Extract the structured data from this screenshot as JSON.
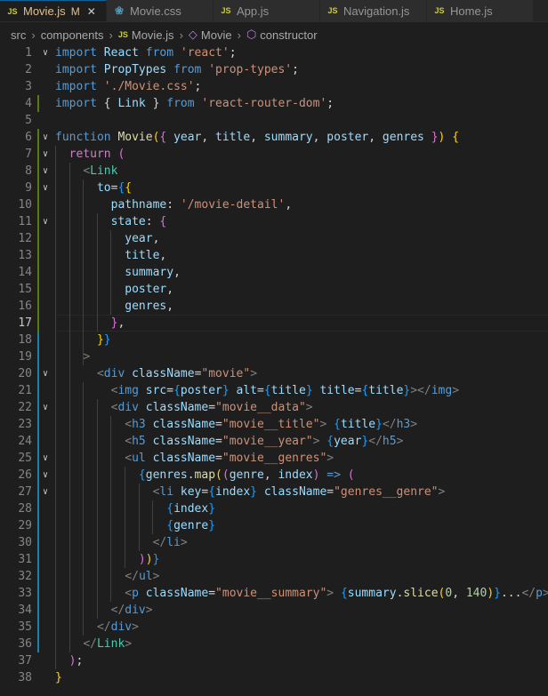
{
  "tabs": [
    {
      "label": "Movie.js",
      "icon": "js-file-icon",
      "modified": "M",
      "active": true
    },
    {
      "label": "Movie.css",
      "icon": "css-file-icon",
      "active": false
    },
    {
      "label": "App.js",
      "icon": "js-file-icon",
      "active": false
    },
    {
      "label": "Navigation.js",
      "icon": "js-file-icon",
      "active": false
    },
    {
      "label": "Home.js",
      "icon": "js-file-icon",
      "active": false
    }
  ],
  "breadcrumb": [
    "src",
    "components",
    "Movie.js",
    "Movie",
    "constructor"
  ],
  "editor": {
    "current_line": 17,
    "lines": [
      {
        "n": 1,
        "fold": true,
        "tokens": [
          [
            "import ",
            "kw"
          ],
          [
            "React ",
            "var"
          ],
          [
            "from ",
            "kw"
          ],
          [
            "'react'",
            "str"
          ],
          [
            ";",
            "pun"
          ]
        ]
      },
      {
        "n": 2,
        "tokens": [
          [
            "import ",
            "kw"
          ],
          [
            "PropTypes ",
            "var"
          ],
          [
            "from ",
            "kw"
          ],
          [
            "'prop-types'",
            "str"
          ],
          [
            ";",
            "pun"
          ]
        ]
      },
      {
        "n": 3,
        "tokens": [
          [
            "import ",
            "kw"
          ],
          [
            "'./Movie.css'",
            "str"
          ],
          [
            ";",
            "pun"
          ]
        ]
      },
      {
        "n": 4,
        "tokens": [
          [
            "import ",
            "kw"
          ],
          [
            "{ ",
            "pun"
          ],
          [
            "Link ",
            "var"
          ],
          [
            "} ",
            "pun"
          ],
          [
            "from ",
            "kw"
          ],
          [
            "'react-router-dom'",
            "str"
          ],
          [
            ";",
            "pun"
          ]
        ]
      },
      {
        "n": 5,
        "tokens": []
      },
      {
        "n": 6,
        "fold": true,
        "tokens": [
          [
            "function ",
            "kw"
          ],
          [
            "Movie",
            "fn"
          ],
          [
            "(",
            "br1"
          ],
          [
            "{ ",
            "br2"
          ],
          [
            "year",
            "var"
          ],
          [
            ", ",
            "pun"
          ],
          [
            "title",
            "var"
          ],
          [
            ", ",
            "pun"
          ],
          [
            "summary",
            "var"
          ],
          [
            ", ",
            "pun"
          ],
          [
            "poster",
            "var"
          ],
          [
            ", ",
            "pun"
          ],
          [
            "genres ",
            "var"
          ],
          [
            "}",
            "br2"
          ],
          [
            ") ",
            "br1"
          ],
          [
            "{",
            "br1"
          ]
        ]
      },
      {
        "n": 7,
        "fold": true,
        "tokens": [
          [
            "  "
          ],
          [
            "return ",
            "ctl"
          ],
          [
            "(",
            "br2"
          ]
        ]
      },
      {
        "n": 8,
        "fold": true,
        "tokens": [
          [
            "    "
          ],
          [
            "<",
            "ang"
          ],
          [
            "Link",
            "comp"
          ]
        ]
      },
      {
        "n": 9,
        "fold": true,
        "tokens": [
          [
            "      "
          ],
          [
            "to",
            "attr"
          ],
          [
            "=",
            "pun"
          ],
          [
            "{",
            "br3"
          ],
          [
            "{",
            "br1"
          ]
        ]
      },
      {
        "n": 10,
        "tokens": [
          [
            "        "
          ],
          [
            "pathname",
            "attr"
          ],
          [
            ": ",
            "pun"
          ],
          [
            "'/movie-detail'",
            "str"
          ],
          [
            ",",
            "pun"
          ]
        ]
      },
      {
        "n": 11,
        "fold": true,
        "tokens": [
          [
            "        "
          ],
          [
            "state",
            "attr"
          ],
          [
            ": ",
            "pun"
          ],
          [
            "{",
            "br2"
          ]
        ]
      },
      {
        "n": 12,
        "tokens": [
          [
            "          "
          ],
          [
            "year",
            "var"
          ],
          [
            ",",
            "pun"
          ]
        ]
      },
      {
        "n": 13,
        "tokens": [
          [
            "          "
          ],
          [
            "title",
            "var"
          ],
          [
            ",",
            "pun"
          ]
        ]
      },
      {
        "n": 14,
        "tokens": [
          [
            "          "
          ],
          [
            "summary",
            "var"
          ],
          [
            ",",
            "pun"
          ]
        ]
      },
      {
        "n": 15,
        "tokens": [
          [
            "          "
          ],
          [
            "poster",
            "var"
          ],
          [
            ",",
            "pun"
          ]
        ]
      },
      {
        "n": 16,
        "tokens": [
          [
            "          "
          ],
          [
            "genres",
            "var"
          ],
          [
            ",",
            "pun"
          ]
        ]
      },
      {
        "n": 17,
        "tokens": [
          [
            "        "
          ],
          [
            "}",
            "br2"
          ],
          [
            ",",
            "pun"
          ]
        ]
      },
      {
        "n": 18,
        "tokens": [
          [
            "      "
          ],
          [
            "}",
            "br1"
          ],
          [
            "}",
            "br3"
          ]
        ]
      },
      {
        "n": 19,
        "tokens": [
          [
            "    "
          ],
          [
            ">",
            "ang"
          ]
        ]
      },
      {
        "n": 20,
        "fold": true,
        "tokens": [
          [
            "      "
          ],
          [
            "<",
            "ang"
          ],
          [
            "div ",
            "tag"
          ],
          [
            "className",
            "attr"
          ],
          [
            "=",
            "pun"
          ],
          [
            "\"movie\"",
            "str"
          ],
          [
            ">",
            "ang"
          ]
        ]
      },
      {
        "n": 21,
        "tokens": [
          [
            "        "
          ],
          [
            "<",
            "ang"
          ],
          [
            "img ",
            "tag"
          ],
          [
            "src",
            "attr"
          ],
          [
            "=",
            "pun"
          ],
          [
            "{",
            "br3"
          ],
          [
            "poster",
            "var"
          ],
          [
            "} ",
            "br3"
          ],
          [
            "alt",
            "attr"
          ],
          [
            "=",
            "pun"
          ],
          [
            "{",
            "br3"
          ],
          [
            "title",
            "var"
          ],
          [
            "} ",
            "br3"
          ],
          [
            "title",
            "attr"
          ],
          [
            "=",
            "pun"
          ],
          [
            "{",
            "br3"
          ],
          [
            "title",
            "var"
          ],
          [
            "}",
            "br3"
          ],
          [
            "></",
            "ang"
          ],
          [
            "img",
            "tag"
          ],
          [
            ">",
            "ang"
          ]
        ]
      },
      {
        "n": 22,
        "fold": true,
        "tokens": [
          [
            "        "
          ],
          [
            "<",
            "ang"
          ],
          [
            "div ",
            "tag"
          ],
          [
            "className",
            "attr"
          ],
          [
            "=",
            "pun"
          ],
          [
            "\"movie__data\"",
            "str"
          ],
          [
            ">",
            "ang"
          ]
        ]
      },
      {
        "n": 23,
        "tokens": [
          [
            "          "
          ],
          [
            "<",
            "ang"
          ],
          [
            "h3 ",
            "tag"
          ],
          [
            "className",
            "attr"
          ],
          [
            "=",
            "pun"
          ],
          [
            "\"movie__title\"",
            "str"
          ],
          [
            "> ",
            "ang"
          ],
          [
            "{",
            "br3"
          ],
          [
            "title",
            "var"
          ],
          [
            "}",
            "br3"
          ],
          [
            "</",
            "ang"
          ],
          [
            "h3",
            "tag"
          ],
          [
            ">",
            "ang"
          ]
        ]
      },
      {
        "n": 24,
        "tokens": [
          [
            "          "
          ],
          [
            "<",
            "ang"
          ],
          [
            "h5 ",
            "tag"
          ],
          [
            "className",
            "attr"
          ],
          [
            "=",
            "pun"
          ],
          [
            "\"movie__year\"",
            "str"
          ],
          [
            "> ",
            "ang"
          ],
          [
            "{",
            "br3"
          ],
          [
            "year",
            "var"
          ],
          [
            "}",
            "br3"
          ],
          [
            "</",
            "ang"
          ],
          [
            "h5",
            "tag"
          ],
          [
            ">",
            "ang"
          ]
        ]
      },
      {
        "n": 25,
        "fold": true,
        "tokens": [
          [
            "          "
          ],
          [
            "<",
            "ang"
          ],
          [
            "ul ",
            "tag"
          ],
          [
            "className",
            "attr"
          ],
          [
            "=",
            "pun"
          ],
          [
            "\"movie__genres\"",
            "str"
          ],
          [
            ">",
            "ang"
          ]
        ]
      },
      {
        "n": 26,
        "fold": true,
        "tokens": [
          [
            "            "
          ],
          [
            "{",
            "br3"
          ],
          [
            "genres",
            "var"
          ],
          [
            ".",
            "pun"
          ],
          [
            "map",
            "fn"
          ],
          [
            "(",
            "br1"
          ],
          [
            "(",
            "br2"
          ],
          [
            "genre",
            "var"
          ],
          [
            ", ",
            "pun"
          ],
          [
            "index",
            "var"
          ],
          [
            ") ",
            "br2"
          ],
          [
            "=> ",
            "kw"
          ],
          [
            "(",
            "br2"
          ]
        ]
      },
      {
        "n": 27,
        "fold": true,
        "tokens": [
          [
            "              "
          ],
          [
            "<",
            "ang"
          ],
          [
            "li ",
            "tag"
          ],
          [
            "key",
            "attr"
          ],
          [
            "=",
            "pun"
          ],
          [
            "{",
            "br3"
          ],
          [
            "index",
            "var"
          ],
          [
            "} ",
            "br3"
          ],
          [
            "className",
            "attr"
          ],
          [
            "=",
            "pun"
          ],
          [
            "\"genres__genre\"",
            "str"
          ],
          [
            ">",
            "ang"
          ]
        ]
      },
      {
        "n": 28,
        "tokens": [
          [
            "                "
          ],
          [
            "{",
            "br3"
          ],
          [
            "index",
            "var"
          ],
          [
            "}",
            "br3"
          ]
        ]
      },
      {
        "n": 29,
        "tokens": [
          [
            "                "
          ],
          [
            "{",
            "br3"
          ],
          [
            "genre",
            "var"
          ],
          [
            "}",
            "br3"
          ]
        ]
      },
      {
        "n": 30,
        "tokens": [
          [
            "              "
          ],
          [
            "</",
            "ang"
          ],
          [
            "li",
            "tag"
          ],
          [
            ">",
            "ang"
          ]
        ]
      },
      {
        "n": 31,
        "tokens": [
          [
            "            "
          ],
          [
            ")",
            "br2"
          ],
          [
            ")",
            "br1"
          ],
          [
            "}",
            "br3"
          ]
        ]
      },
      {
        "n": 32,
        "tokens": [
          [
            "          "
          ],
          [
            "</",
            "ang"
          ],
          [
            "ul",
            "tag"
          ],
          [
            ">",
            "ang"
          ]
        ]
      },
      {
        "n": 33,
        "tokens": [
          [
            "          "
          ],
          [
            "<",
            "ang"
          ],
          [
            "p ",
            "tag"
          ],
          [
            "className",
            "attr"
          ],
          [
            "=",
            "pun"
          ],
          [
            "\"movie__summary\"",
            "str"
          ],
          [
            "> ",
            "ang"
          ],
          [
            "{",
            "br3"
          ],
          [
            "summary",
            "var"
          ],
          [
            ".",
            "pun"
          ],
          [
            "slice",
            "fn"
          ],
          [
            "(",
            "br1"
          ],
          [
            "0",
            "num"
          ],
          [
            ", ",
            "pun"
          ],
          [
            "140",
            "num"
          ],
          [
            ")",
            "br1"
          ],
          [
            "}",
            "br3"
          ],
          [
            "...",
            "tx"
          ],
          [
            "</",
            "ang"
          ],
          [
            "p",
            "tag"
          ],
          [
            ">",
            "ang"
          ]
        ]
      },
      {
        "n": 34,
        "tokens": [
          [
            "        "
          ],
          [
            "</",
            "ang"
          ],
          [
            "div",
            "tag"
          ],
          [
            ">",
            "ang"
          ]
        ]
      },
      {
        "n": 35,
        "tokens": [
          [
            "      "
          ],
          [
            "</",
            "ang"
          ],
          [
            "div",
            "tag"
          ],
          [
            ">",
            "ang"
          ]
        ]
      },
      {
        "n": 36,
        "tokens": [
          [
            "    "
          ],
          [
            "</",
            "ang"
          ],
          [
            "Link",
            "comp"
          ],
          [
            ">",
            "ang"
          ]
        ]
      },
      {
        "n": 37,
        "tokens": [
          [
            "  "
          ],
          [
            ")",
            "br2"
          ],
          [
            ";",
            "pun"
          ]
        ]
      },
      {
        "n": 38,
        "tokens": [
          [
            "}",
            "br1"
          ]
        ]
      }
    ]
  }
}
